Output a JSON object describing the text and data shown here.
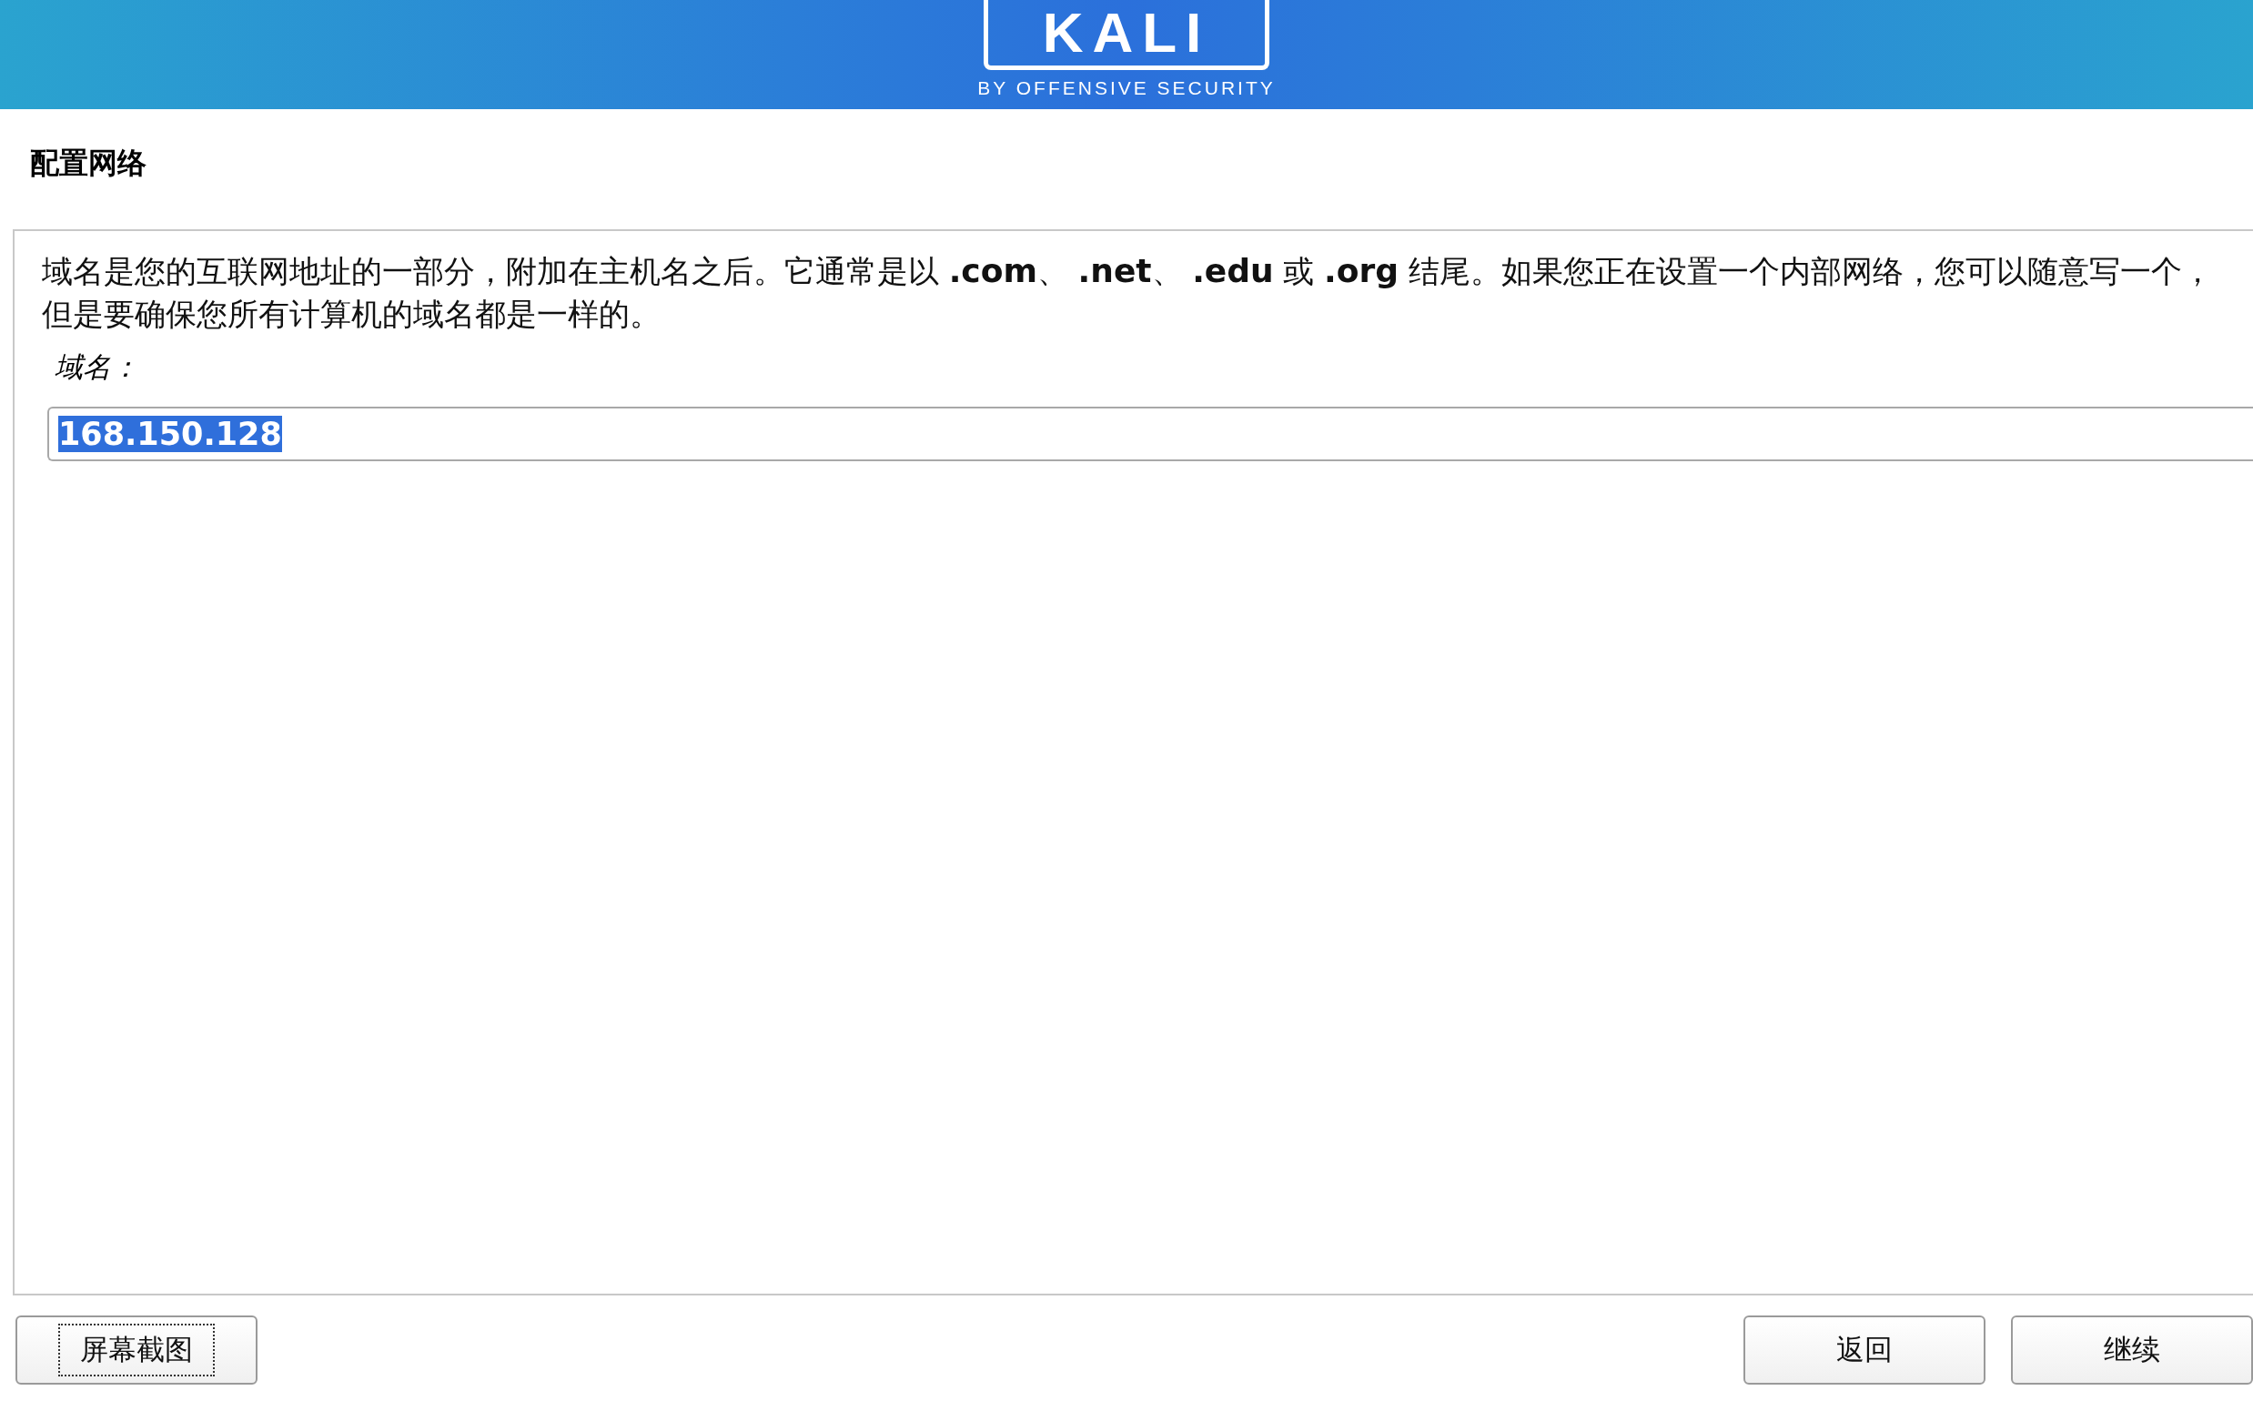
{
  "header": {
    "logo": "KALI",
    "tagline": "BY OFFENSIVE SECURITY"
  },
  "title": "配置网络",
  "description": "域名是您的互联网地址的一部分，附加在主机名之后。它通常是以 **.com**、 **.net**、 **.edu** 或 **.org** 结尾。如果您正在设置一个内部网络，您可以随意写一个，但是要确保您所有计算机的域名都是一样的。",
  "field": {
    "label": "域名：",
    "value": "168.150.128",
    "value_selected": true
  },
  "buttons": [
    {
      "label": "屏幕截图",
      "focused": true,
      "kind": "left"
    },
    {
      "label": "返回",
      "focused": false,
      "kind": "right"
    },
    {
      "label": "继续",
      "focused": false,
      "kind": "right"
    }
  ]
}
